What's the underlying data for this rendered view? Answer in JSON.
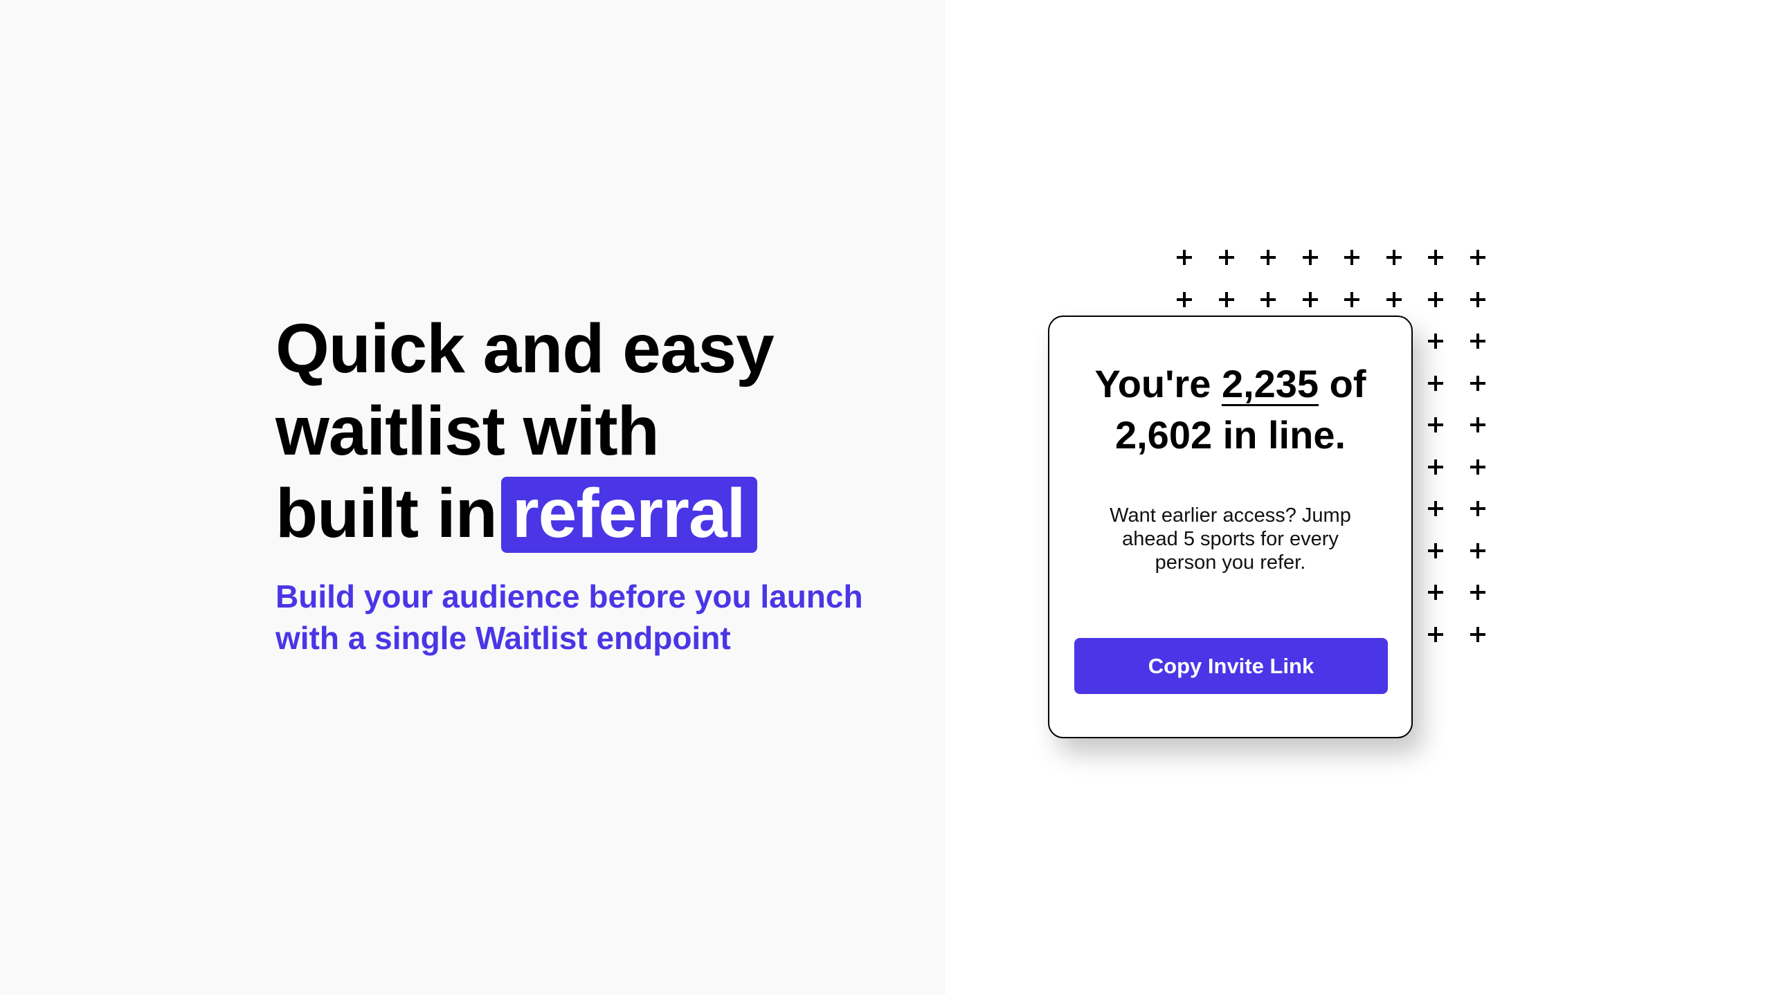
{
  "hero": {
    "headline_lines": [
      "Quick and easy",
      "waitlist with",
      "built in"
    ],
    "highlight_word": "referral",
    "subtitle_lines": [
      "Build your audience before you launch",
      "with a single Waitlist endpoint"
    ]
  },
  "card": {
    "title_prefix": "You're",
    "position": "2,235",
    "title_mid": "of",
    "total": "2,602",
    "title_suffix": "in line.",
    "body": "Want earlier access? Jump ahead 5 sports for every person you refer.",
    "button_label": "Copy Invite Link"
  },
  "decoration": {
    "icon": "plus-icon",
    "grid_columns": 8,
    "grid_rows": 10
  },
  "colors": {
    "accent": "#4a36e6",
    "left_background": "#f9f9f9",
    "right_background": "#ffffff",
    "text": "#000000"
  }
}
